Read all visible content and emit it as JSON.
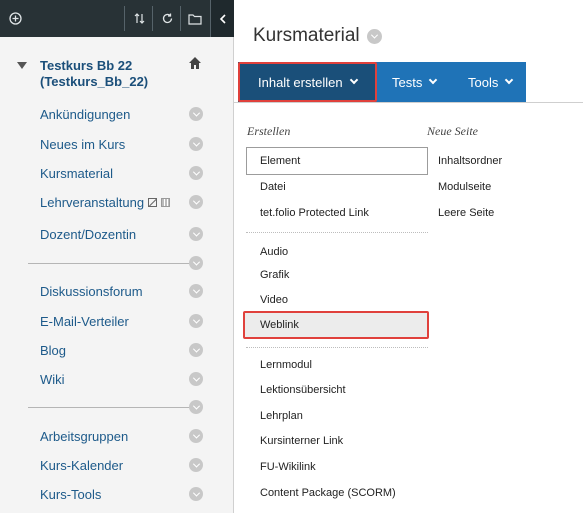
{
  "sidebar": {
    "toolbar": {
      "add_icon": "add-circle-icon",
      "sort_icon": "sort-arrows-icon",
      "refresh_icon": "refresh-icon",
      "folder_icon": "folder-icon",
      "collapse_icon": "chevron-left-icon"
    },
    "course_title": "Testkurs Bb 22 (Testkurs_Bb_22)",
    "items": [
      {
        "label": "Ankündigungen"
      },
      {
        "label": "Neues im Kurs"
      },
      {
        "label": "Kursmaterial"
      },
      {
        "label": "Lehrveranstaltung"
      },
      {
        "label": "Dozent/Dozentin"
      },
      {
        "label": "Diskussionsforum"
      },
      {
        "label": "E-Mail-Verteiler"
      },
      {
        "label": "Blog"
      },
      {
        "label": "Wiki"
      },
      {
        "label": "Arbeitsgruppen"
      },
      {
        "label": "Kurs-Kalender"
      },
      {
        "label": "Kurs-Tools"
      }
    ]
  },
  "main": {
    "title": "Kursmaterial",
    "action_bar": {
      "create": "Inhalt erstellen",
      "tests": "Tests",
      "tools": "Tools"
    },
    "dropdown": {
      "left_heading": "Erstellen",
      "right_heading": "Neue Seite",
      "group1": [
        "Element",
        "Datei",
        "tet.folio Protected Link"
      ],
      "group2": [
        "Audio",
        "Grafik",
        "Video",
        "Weblink"
      ],
      "group3": [
        "Lernmodul",
        "Lektionsübersicht",
        "Lehrplan",
        "Kursinterner Link",
        "FU-Wikilink",
        "Content Package (SCORM)"
      ],
      "right_items": [
        "Inhaltsordner",
        "Modulseite",
        "Leere Seite"
      ]
    }
  },
  "colors": {
    "toolbar_bg": "#283236",
    "action_bar": "#1f73b7",
    "action_active": "#1a4f79",
    "highlight": "#e0413c",
    "nav_link": "#1d5a8a"
  }
}
